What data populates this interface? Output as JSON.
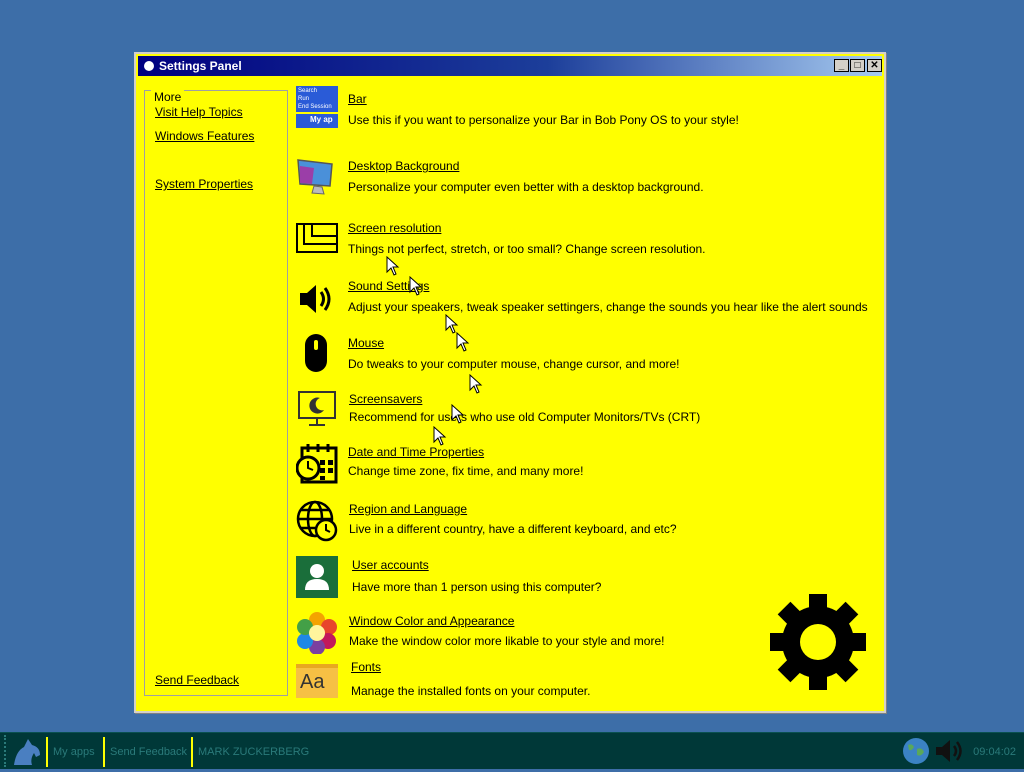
{
  "window": {
    "title": "Settings Panel",
    "controls": {
      "minimize": "_",
      "maximize": "□",
      "close": "✕"
    }
  },
  "sidebar": {
    "heading": "More",
    "links": [
      "Visit Help Topics",
      "Windows Features",
      "System Properties"
    ],
    "footer_link": "Send Feedback"
  },
  "bar_icon": {
    "items": [
      "Search",
      "Run",
      "End Session"
    ],
    "button": "My ap"
  },
  "settings": [
    {
      "title": "Bar",
      "description": "Use this if you want to personalize your Bar in Bob Pony OS to your style!",
      "icon": "bar-icon"
    },
    {
      "title": "Desktop Background",
      "description": "Personalize your computer even better with a desktop background.",
      "icon": "monitor-icon"
    },
    {
      "title": "Screen resolution",
      "description": "Things not perfect, stretch, or too small? Change screen resolution.",
      "icon": "resolution-icon"
    },
    {
      "title": "Sound Settings",
      "description": "Adjust your speakers, tweak speaker settingers, change the sounds you hear like the alert sounds",
      "icon": "speaker-icon"
    },
    {
      "title": "Mouse",
      "description": "Do tweaks to your computer mouse, change cursor, and more!",
      "icon": "mouse-icon"
    },
    {
      "title": "Screensavers",
      "description": "Recommend for users who use old Computer Monitors/TVs (CRT)",
      "icon": "screensaver-icon"
    },
    {
      "title": "Date and Time Properties",
      "description": "Change time zone, fix time, and many more!",
      "icon": "calendar-clock-icon"
    },
    {
      "title": "Region and Language",
      "description": "Live in a different country, have a different keyboard, and etc?",
      "icon": "globe-clock-icon"
    },
    {
      "title": "User accounts",
      "description": "Have more than 1 person using this computer?",
      "icon": "user-icon"
    },
    {
      "title": "Window Color and Appearance",
      "description": "Make the window color more likable to your style and more!",
      "icon": "color-wheel-icon"
    },
    {
      "title": "Fonts",
      "description": "Manage the installed fonts on your computer.",
      "icon": "fonts-icon"
    }
  ],
  "font_icon_label": "Aa",
  "taskbar": {
    "items": [
      "My apps",
      "Send Feedback",
      "MARK ZUCKERBERG"
    ],
    "clock": "09:04:02"
  },
  "colors": {
    "desktop": "#3d6ea8",
    "window_bg": "#ffff00",
    "taskbar": "#003838",
    "title_gradient_start": "#000080",
    "user_icon_bg": "#1a6e3a"
  }
}
